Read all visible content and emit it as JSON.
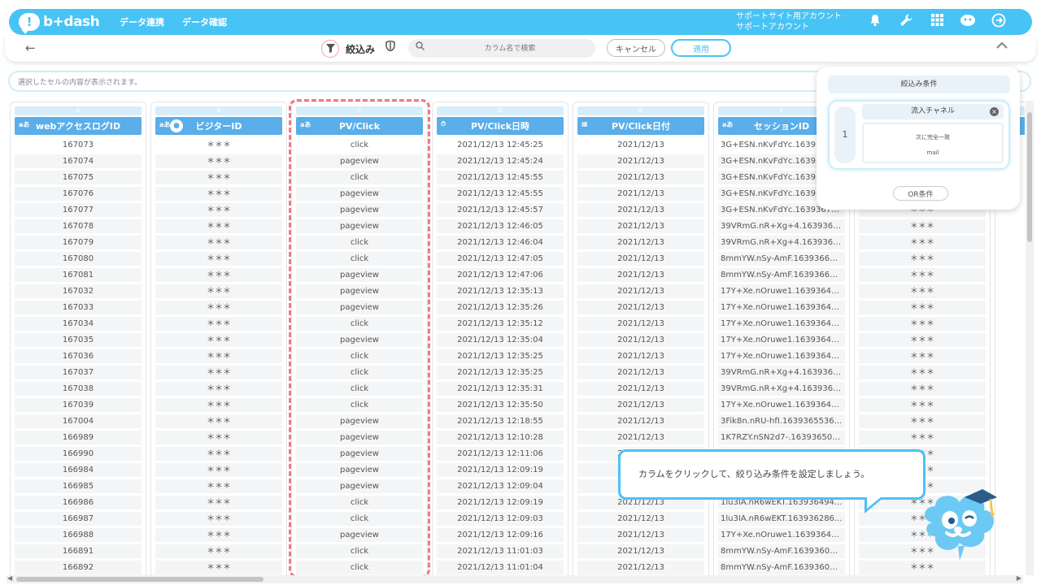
{
  "brand": {
    "logo_text": "b+dash"
  },
  "nav": {
    "links": [
      "データ連携",
      "データ確認"
    ]
  },
  "account": {
    "line1": "サポートサイト用アカウント",
    "line2": "サポートアカウント"
  },
  "toolbar": {
    "filter_label": "絞込み",
    "search_placeholder": "カラム名で検索",
    "cancel_label": "キャンセル",
    "apply_label": "適用"
  },
  "cell_bar": {
    "placeholder": "選択したセルの内容が表示されます。"
  },
  "columns": [
    {
      "letter": "A",
      "header": "webアクセスログID",
      "type_icon": "text",
      "values": [
        "167073",
        "167074",
        "167075",
        "167076",
        "167077",
        "167078",
        "167079",
        "167080",
        "167081",
        "167032",
        "167033",
        "167034",
        "167035",
        "167036",
        "167037",
        "167038",
        "167039",
        "167004",
        "166989",
        "166990",
        "166984",
        "166985",
        "166986",
        "166987",
        "166988",
        "166891",
        "166892"
      ]
    },
    {
      "letter": "B",
      "header": "ビジターID",
      "type_icon": "text",
      "values": [
        "＊＊＊",
        "＊＊＊",
        "＊＊＊",
        "＊＊＊",
        "＊＊＊",
        "＊＊＊",
        "＊＊＊",
        "＊＊＊",
        "＊＊＊",
        "＊＊＊",
        "＊＊＊",
        "＊＊＊",
        "＊＊＊",
        "＊＊＊",
        "＊＊＊",
        "＊＊＊",
        "＊＊＊",
        "＊＊＊",
        "＊＊＊",
        "＊＊＊",
        "＊＊＊",
        "＊＊＊",
        "＊＊＊",
        "＊＊＊",
        "＊＊＊",
        "＊＊＊",
        "＊＊＊"
      ]
    },
    {
      "letter": "C",
      "header": "PV/Click",
      "type_icon": "text",
      "values": [
        "click",
        "pageview",
        "click",
        "pageview",
        "pageview",
        "pageview",
        "click",
        "click",
        "pageview",
        "pageview",
        "pageview",
        "click",
        "pageview",
        "click",
        "click",
        "click",
        "click",
        "pageview",
        "pageview",
        "pageview",
        "pageview",
        "pageview",
        "click",
        "click",
        "pageview",
        "click",
        "click"
      ]
    },
    {
      "letter": "D",
      "header": "PV/Click日時",
      "type_icon": "datetime",
      "values": [
        "2021/12/13 12:45:25",
        "2021/12/13 12:45:24",
        "2021/12/13 12:45:55",
        "2021/12/13 12:45:55",
        "2021/12/13 12:45:57",
        "2021/12/13 12:46:05",
        "2021/12/13 12:46:04",
        "2021/12/13 12:47:05",
        "2021/12/13 12:47:06",
        "2021/12/13 12:35:13",
        "2021/12/13 12:35:26",
        "2021/12/13 12:35:12",
        "2021/12/13 12:35:04",
        "2021/12/13 12:35:25",
        "2021/12/13 12:35:25",
        "2021/12/13 12:35:31",
        "2021/12/13 12:35:50",
        "2021/12/13 12:18:55",
        "2021/12/13 12:10:28",
        "2021/12/13 12:11:06",
        "2021/12/13 12:09:19",
        "2021/12/13 12:09:04",
        "2021/12/13 12:09:19",
        "2021/12/13 12:09:03",
        "2021/12/13 12:09:16",
        "2021/12/13 11:01:03",
        "2021/12/13 11:01:04"
      ]
    },
    {
      "letter": "E",
      "header": "PV/Click日付",
      "type_icon": "date",
      "values": [
        "2021/12/13",
        "2021/12/13",
        "2021/12/13",
        "2021/12/13",
        "2021/12/13",
        "2021/12/13",
        "2021/12/13",
        "2021/12/13",
        "2021/12/13",
        "2021/12/13",
        "2021/12/13",
        "2021/12/13",
        "2021/12/13",
        "2021/12/13",
        "2021/12/13",
        "2021/12/13",
        "2021/12/13",
        "2021/12/13",
        "2021/12/13",
        "2021/12/13",
        "2021/12/13",
        "2021/12/13",
        "2021/12/13",
        "2021/12/13",
        "2021/12/13",
        "2021/12/13",
        "2021/12/13"
      ]
    },
    {
      "letter": "F",
      "header": "セッションID",
      "type_icon": "text",
      "values": [
        "3G+ESN.nKvFdYc.163936",
        "3G+ESN.nKvFdYc.163936",
        "3G+ESN.nKvFdYc.163936",
        "3G+ESN.nKvFdYc.163936",
        "3G+ESN.nKvFdYc.163936701...",
        "39VRmG.nR+Xg+4.16393655...",
        "39VRmG.nR+Xg+4.16393655...",
        "8mmYW.nSy-AmF.163936629...",
        "8mmYW.nSy-AmF.163936629...",
        "17Y+Xe.nOruwe1.16393649...",
        "17Y+Xe.nOruwe1.16393649...",
        "17Y+Xe.nOruwe1.16393649...",
        "17Y+Xe.nOruwe1.16393649...",
        "17Y+Xe.nOruwe1.16393649...",
        "39VRmG.nR+Xg+4.16393655...",
        "39VRmG.nR+Xg+4.16393655...",
        "17Y+Xe.nOruwe1.16393649...",
        "3Fik8n.nRU-hfI.1639365536...",
        "1K7RZY.nSN2d7-.163936502...",
        "",
        "",
        "",
        "1lu3IA.nR6wEKT.163936494...",
        "1lu3IA.nR6wEKT.163936286...",
        "17Y+Xe.nOruwe1.16393649...",
        "8mmYW.nSy-AmF.163936019...",
        "8mmYW.nSy-AmF.163936019..."
      ]
    },
    {
      "letter": "G",
      "header": "",
      "type_icon": "text",
      "values": [
        "",
        "",
        "",
        "",
        "＊＊＊",
        "＊＊＊",
        "＊＊＊",
        "＊＊＊",
        "＊＊＊",
        "＊＊＊",
        "＊＊＊",
        "＊＊＊",
        "＊＊＊",
        "＊＊＊",
        "＊＊＊",
        "＊＊＊",
        "＊＊＊",
        "＊＊＊",
        "＊＊＊",
        "＊＊＊",
        "＊＊＊",
        "＊＊＊",
        "＊＊＊",
        "＊＊＊",
        "＊＊＊",
        "＊＊＊",
        "＊＊＊"
      ]
    }
  ],
  "filter_panel": {
    "title": "絞込み条件",
    "condition_number": "1",
    "field": "流入チャネル",
    "operator": "次に完全一致",
    "value": "mail",
    "or_button": "OR条件"
  },
  "tooltip": {
    "text": "カラムをクリックして、絞り込み条件を設定しましょう。"
  },
  "colors": {
    "brand": "#48c3f5",
    "header_blue": "#5aaee9",
    "highlight_dash": "#f07a82"
  }
}
